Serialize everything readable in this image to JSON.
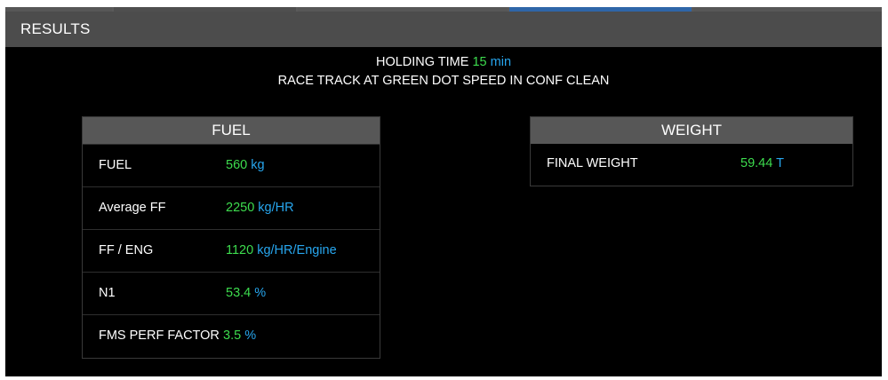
{
  "header": {
    "title": "RESULTS"
  },
  "summary": {
    "holding_label": "HOLDING TIME",
    "holding_value": "15",
    "holding_unit": "min",
    "subtitle": "RACE TRACK AT GREEN DOT SPEED IN CONF CLEAN"
  },
  "fuel_panel": {
    "title": "FUEL",
    "rows": [
      {
        "label": "FUEL",
        "value": "560",
        "unit": "kg"
      },
      {
        "label": "Average FF",
        "value": "2250",
        "unit": "kg/HR"
      },
      {
        "label": "FF / ENG",
        "value": "1120",
        "unit": "kg/HR/Engine"
      },
      {
        "label": "N1",
        "value": "53.4",
        "unit": "%"
      },
      {
        "label": "FMS PERF FACTOR",
        "value": "3.5",
        "unit": "%"
      }
    ]
  },
  "weight_panel": {
    "title": "WEIGHT",
    "rows": [
      {
        "label": "FINAL WEIGHT",
        "value": "59.44",
        "unit": "T"
      }
    ]
  },
  "colors": {
    "value_green": "#3ddc4e",
    "unit_blue": "#27a6ee",
    "header_bg": "#4c4c4c",
    "panel_head_bg": "#575757",
    "active_tab": "#2f66a8"
  }
}
